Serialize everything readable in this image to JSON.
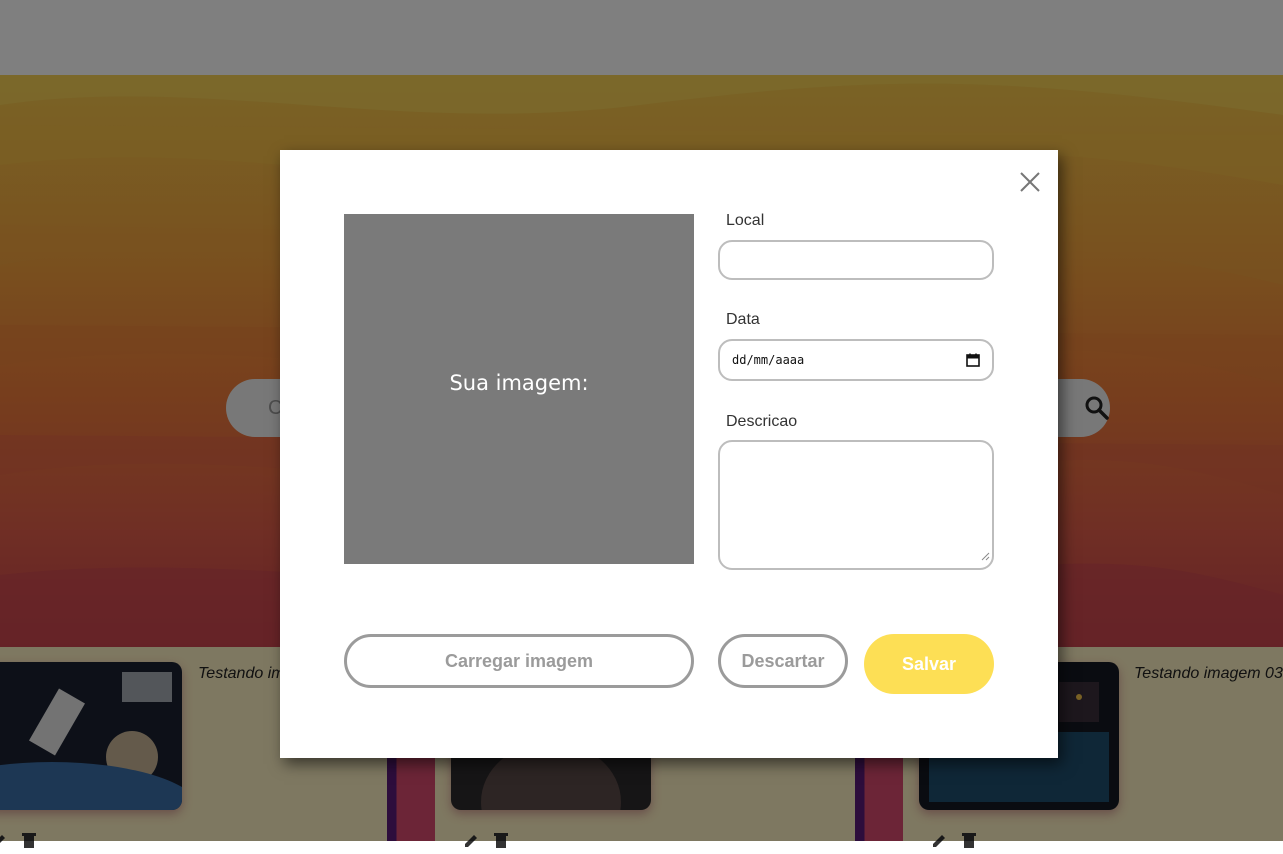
{
  "search": {
    "placeholder": "C"
  },
  "gallery": {
    "cards": [
      {
        "title": "Testando im"
      },
      {
        "title": ""
      },
      {
        "title": "Testando imagem 03"
      }
    ]
  },
  "modal": {
    "preview_label": "Sua imagem:",
    "local_label": "Local",
    "local_value": "",
    "date_label": "Data",
    "date_placeholder": "dd/mm/aaaa",
    "description_label": "Descricao",
    "description_value": "",
    "load_button": "Carregar imagem",
    "discard_button": "Descartar",
    "save_button": "Salvar"
  },
  "colors": {
    "save_accent": "#fddf55",
    "outline_gray": "#9b9b9b",
    "overlay": "rgba(0,0,0,0.5)"
  }
}
